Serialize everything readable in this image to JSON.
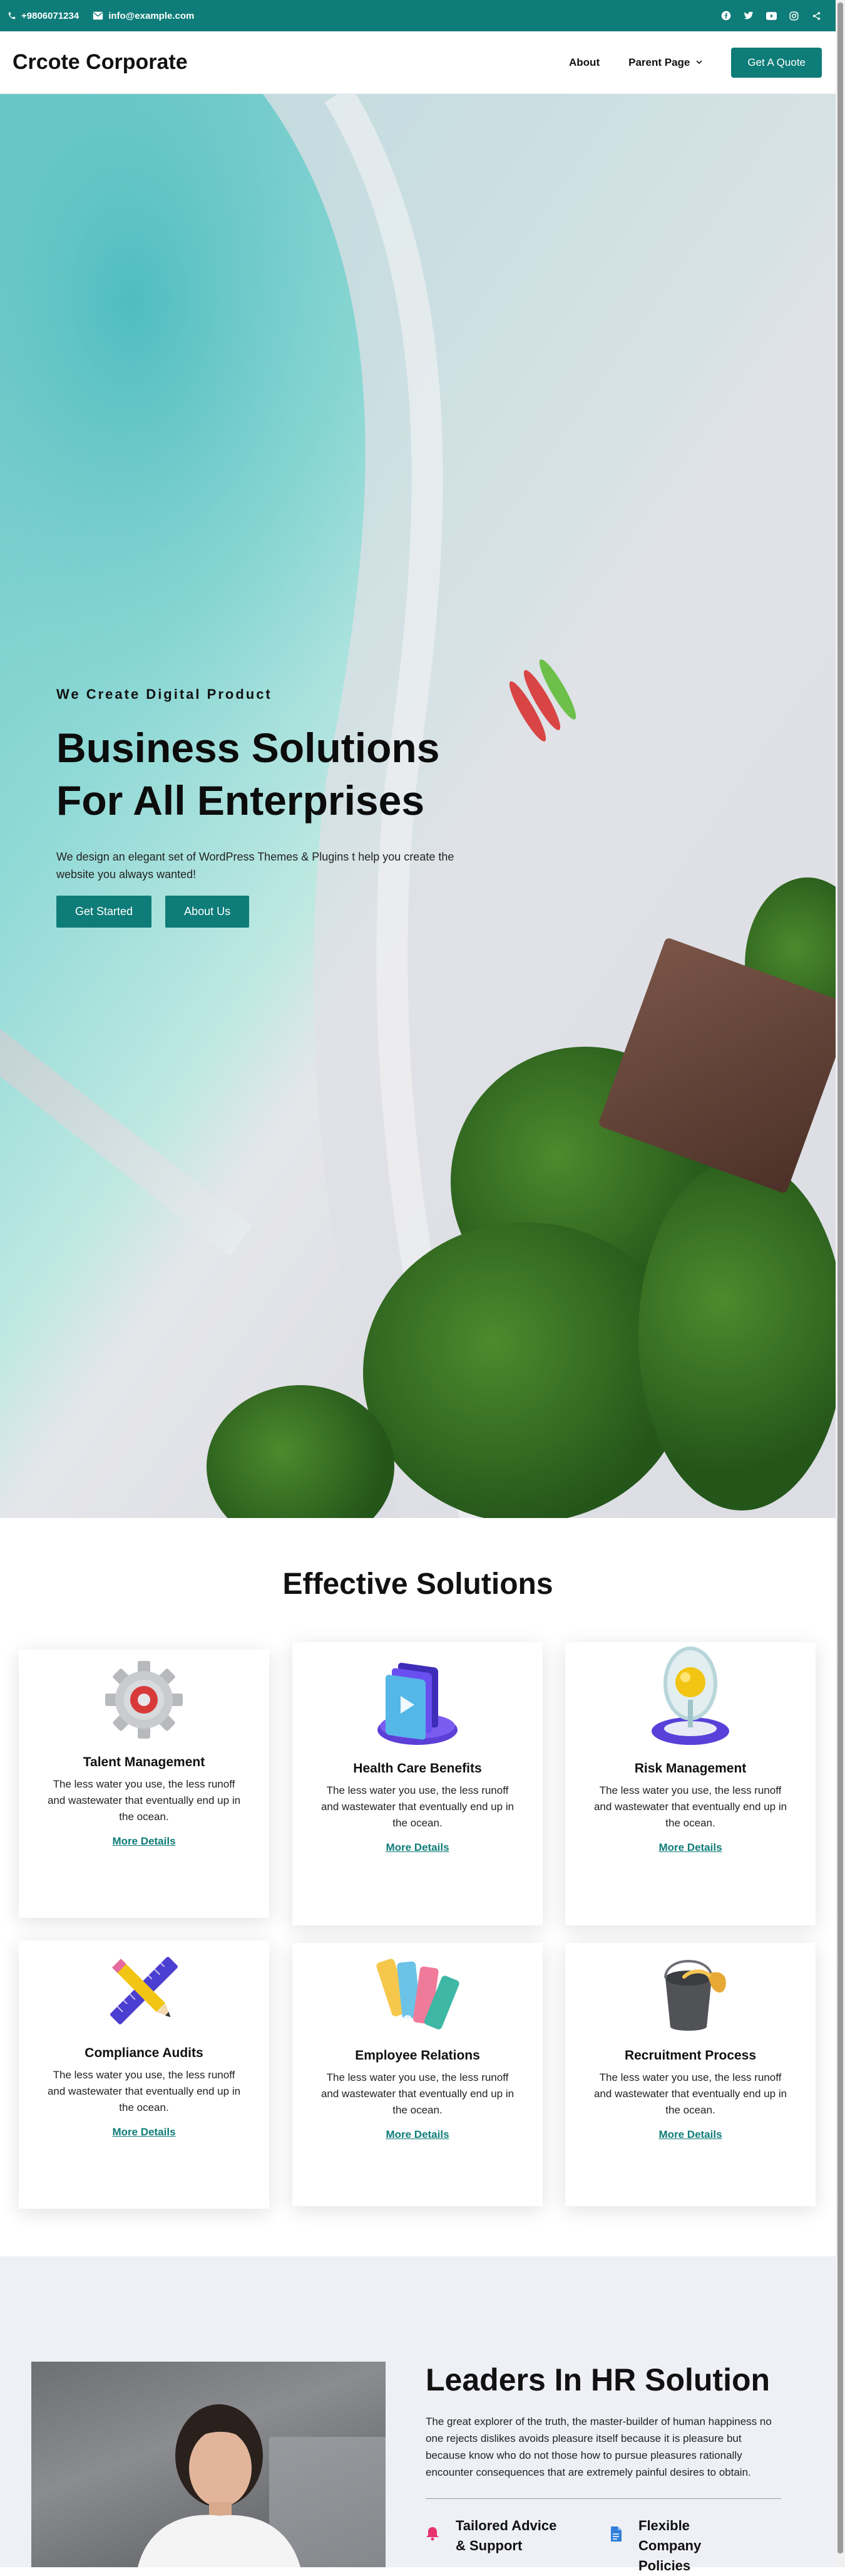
{
  "topbar": {
    "phone": "+9806071234",
    "email": "info@example.com",
    "social": [
      "facebook-icon",
      "twitter-icon",
      "youtube-icon",
      "instagram-icon",
      "share-icon"
    ]
  },
  "header": {
    "logo": "Crcote Corporate",
    "nav": {
      "about": "About",
      "parent": "Parent Page"
    },
    "quote_button": "Get A Quote"
  },
  "hero": {
    "eyebrow": "We Create Digital Product",
    "title_line1": "Business Solutions",
    "title_line2": "For All Enterprises",
    "description": "We design an elegant set of WordPress Themes & Plugins t help you create the website you always wanted!",
    "primary_button": "Get Started",
    "secondary_button": "About Us"
  },
  "solutions": {
    "title": "Effective Solutions",
    "cards": [
      {
        "title": "Talent Management",
        "text": "The less water you use, the less runoff and wastewater that eventually end up in the ocean.",
        "link": "More Details",
        "icon": "gear-icon"
      },
      {
        "title": "Health Care Benefits",
        "text": "The less water you use, the less runoff and wastewater that eventually end up in the ocean.",
        "link": "More Details",
        "icon": "video-stack-icon"
      },
      {
        "title": "Risk Management",
        "text": "The less water you use, the less runoff and wastewater that eventually end up in the ocean.",
        "link": "More Details",
        "icon": "location-pin-icon"
      },
      {
        "title": "Compliance Audits",
        "text": "The less water you use, the less runoff and wastewater that eventually end up in the ocean.",
        "link": "More Details",
        "icon": "pencil-ruler-icon"
      },
      {
        "title": "Employee Relations",
        "text": "The less water you use, the less runoff and wastewater that eventually end up in the ocean.",
        "link": "More Details",
        "icon": "color-swatch-icon"
      },
      {
        "title": "Recruitment Process",
        "text": "The less water you use, the less runoff and wastewater that eventually end up in the ocean.",
        "link": "More Details",
        "icon": "paint-bucket-icon"
      }
    ]
  },
  "hr": {
    "title": "Leaders In HR Solution",
    "text": "The great explorer of the truth, the master-builder of human happiness no one rejects dislikes avoids pleasure itself because it is pleasure but because know who do not those how to pursue pleasures rationally encounter consequences that are extremely painful desires to obtain.",
    "features": [
      {
        "label": "Tailored Advice & Support",
        "icon": "bell-icon"
      },
      {
        "label": "Flexible Company Policies",
        "icon": "document-icon"
      }
    ]
  },
  "colors": {
    "brand": "#0e7c78",
    "accent_pink": "#e8336d",
    "accent_blue": "#2f7fd8"
  }
}
